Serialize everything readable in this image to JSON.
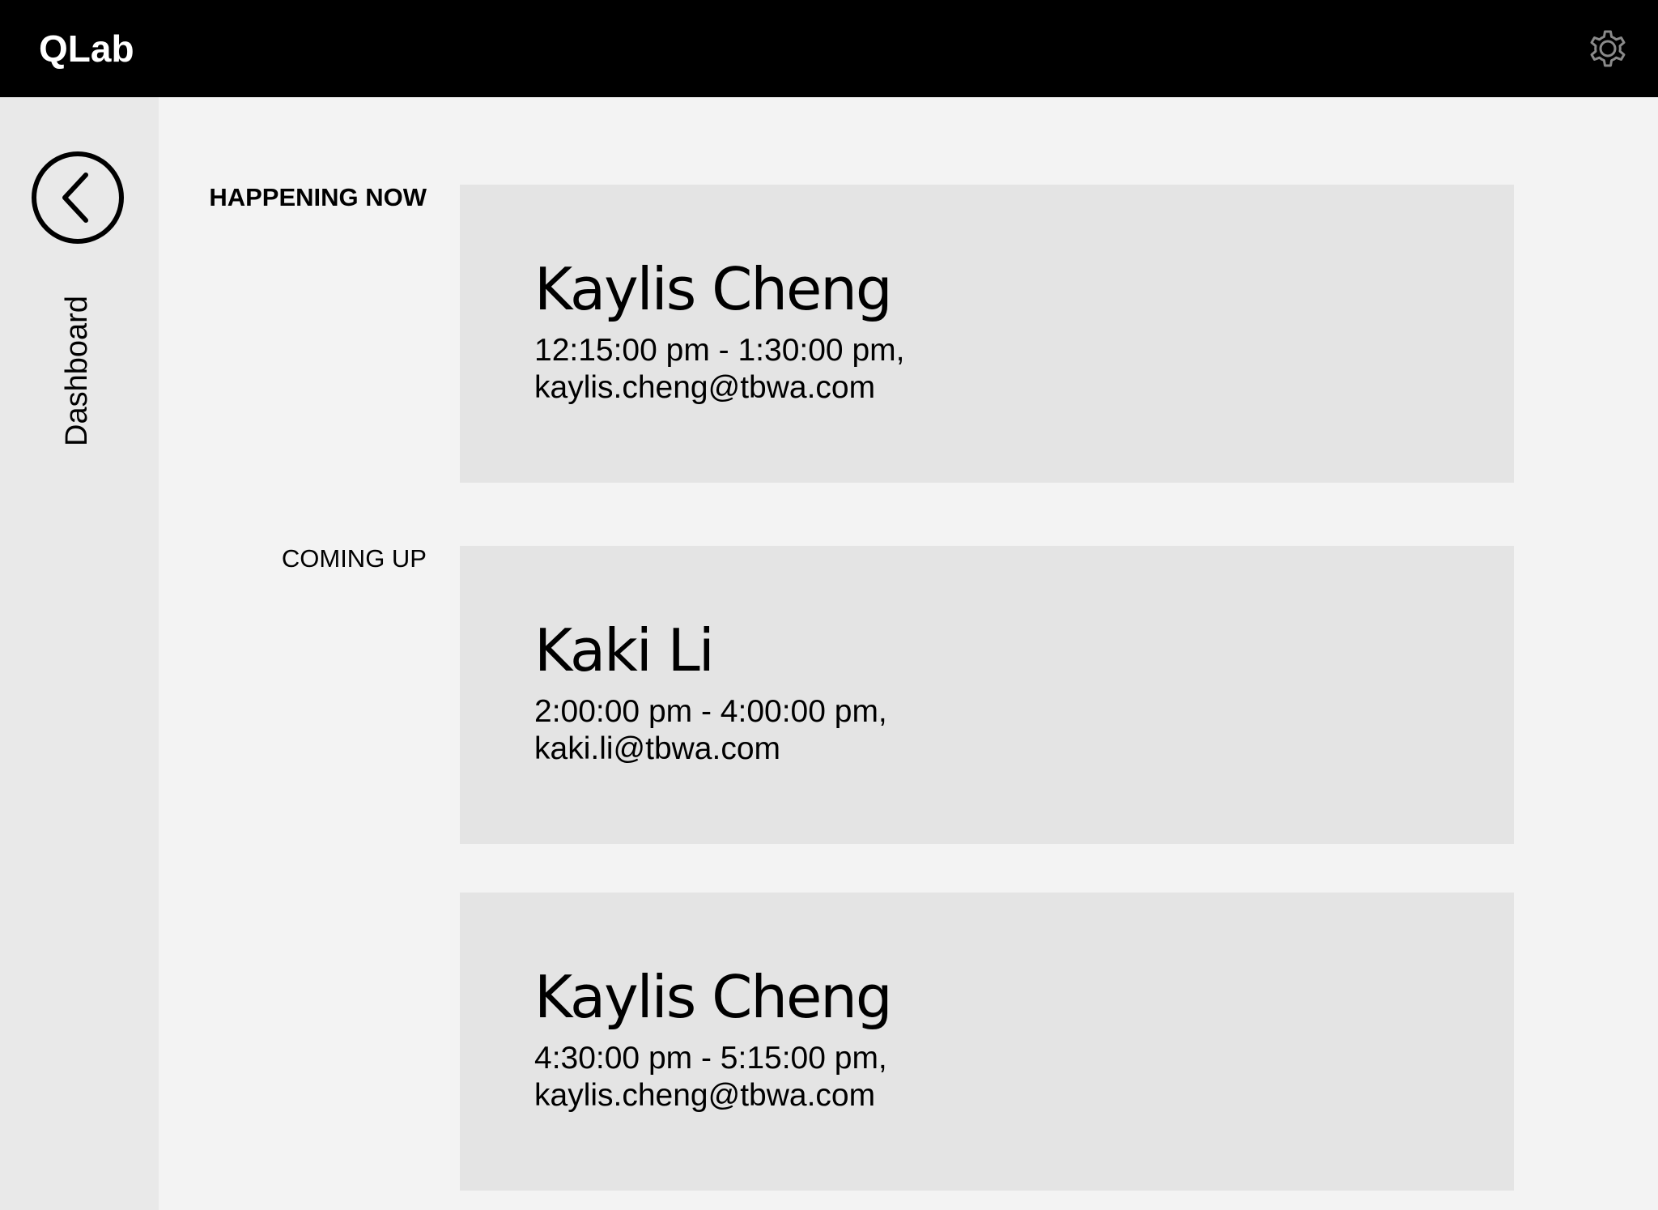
{
  "header": {
    "title": "QLab",
    "settings_icon": "gear-icon"
  },
  "sidebar": {
    "back_icon": "chevron-left-icon",
    "label": "Dashboard"
  },
  "sections": {
    "now_label": "HAPPENING NOW",
    "up_label": "COMING UP"
  },
  "bookings": [
    {
      "name": "Kaylis Cheng",
      "time": "12:15:00 pm - 1:30:00 pm,",
      "email": "kaylis.cheng@tbwa.com"
    },
    {
      "name": "Kaki Li",
      "time": "2:00:00 pm - 4:00:00 pm,",
      "email": "kaki.li@tbwa.com"
    },
    {
      "name": "Kaylis Cheng",
      "time": "4:30:00 pm - 5:15:00 pm,",
      "email": "kaylis.cheng@tbwa.com"
    }
  ],
  "colors": {
    "header_bg": "#000000",
    "page_bg": "#f3f3f3",
    "sidebar_bg": "#e9e9e9",
    "card_bg": "#e4e4e4"
  }
}
